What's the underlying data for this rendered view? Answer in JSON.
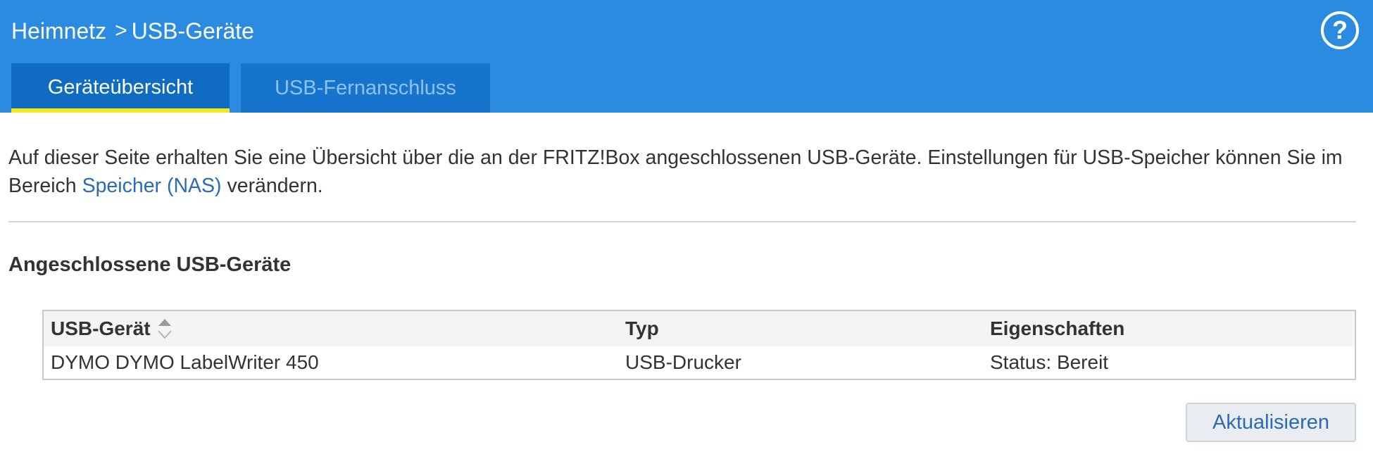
{
  "header": {
    "breadcrumb": [
      "Heimnetz",
      "USB-Geräte"
    ],
    "breadcrumb_separator": ">",
    "help_label": "?",
    "background_color": "#2a8be0"
  },
  "tabs": [
    {
      "label": "Geräteübersicht",
      "active": true
    },
    {
      "label": "USB-Fernanschluss",
      "active": false
    }
  ],
  "intro": {
    "text_before": "Auf dieser Seite erhalten Sie eine Übersicht über die an der FRITZ!Box angeschlossenen USB-Geräte. Einstellungen für USB-Speicher können Sie im Bereich ",
    "link_text": "Speicher (NAS)",
    "text_after": " verändern."
  },
  "section": {
    "title": "Angeschlossene USB-Geräte"
  },
  "table": {
    "columns": [
      "USB-Gerät",
      "Typ",
      "Eigenschaften"
    ],
    "sort_icon": "sort-arrows-icon",
    "rows": [
      [
        "DYMO DYMO LabelWriter 450",
        "USB-Drucker",
        "Status: Bereit"
      ]
    ]
  },
  "actions": {
    "refresh_label": "Aktualisieren"
  },
  "colors": {
    "accent": "#2a8be0",
    "tab_active": "#0f6cc2",
    "tab_underline": "#f2ea1e",
    "link": "#2a6bb4"
  }
}
